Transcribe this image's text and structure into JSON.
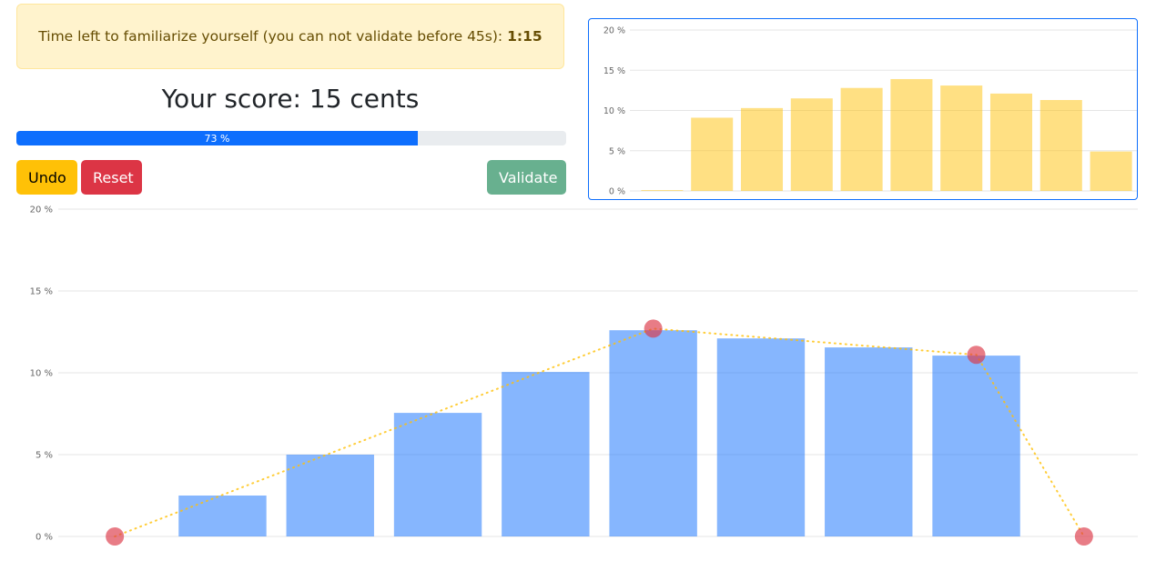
{
  "timer": {
    "text": "Time left to familiarize yourself (you can not validate before 45s):",
    "value": "1:15"
  },
  "score": {
    "text": "Your score: 15 cents"
  },
  "progress": {
    "value": 73,
    "label": "73 %"
  },
  "buttons": {
    "undo": "Undo",
    "reset": "Reset",
    "validate": "Validate"
  },
  "colors": {
    "mini_bar": "#ffc107",
    "main_bar": "#0d6efd",
    "point": "#dc3545",
    "line": "#ffc107"
  },
  "chart_data": [
    {
      "type": "bar",
      "ylim": [
        0,
        20
      ],
      "yticks": [
        "0 %",
        "5 %",
        "10 %",
        "15 %",
        "20 %"
      ],
      "grid": true,
      "values": [
        0.1,
        9.1,
        10.3,
        11.5,
        12.8,
        13.9,
        13.1,
        12.1,
        11.3,
        4.9
      ]
    },
    {
      "type": "bar",
      "ylim": [
        0,
        20
      ],
      "yticks": [
        "0 %",
        "5 %",
        "10 %",
        "15 %",
        "20 %"
      ],
      "grid": true,
      "values": [
        0,
        2.5,
        5.0,
        7.55,
        10.05,
        12.6,
        12.1,
        11.55,
        11.05,
        0
      ],
      "line_points": [
        {
          "index": 0,
          "value": 0
        },
        {
          "index": 5,
          "value": 12.7
        },
        {
          "index": 8,
          "value": 11.1
        },
        {
          "index": 9,
          "value": 0
        }
      ]
    }
  ]
}
